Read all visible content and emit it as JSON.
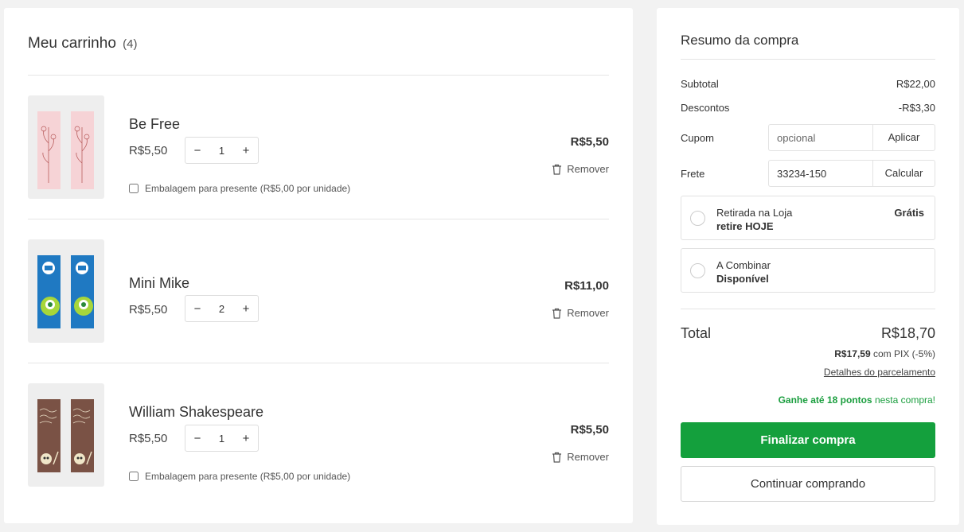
{
  "cart": {
    "title": "Meu carrinho",
    "count": "(4)",
    "items": [
      {
        "name": "Be Free",
        "unit_price": "R$5,50",
        "qty": "1",
        "total": "R$5,50",
        "remove_label": "Remover",
        "gift_label": "Embalagem para presente (R$5,00 por unidade)",
        "thumb_colors": [
          "#f6d3d6",
          "#b85c5c"
        ]
      },
      {
        "name": "Mini Mike",
        "unit_price": "R$5,50",
        "qty": "2",
        "total": "R$11,00",
        "remove_label": "Remover",
        "thumb_colors": [
          "#1f79c2",
          "#a7d63a"
        ]
      },
      {
        "name": "William Shakespeare",
        "unit_price": "R$5,50",
        "qty": "1",
        "total": "R$5,50",
        "remove_label": "Remover",
        "gift_label": "Embalagem para presente (R$5,00 por unidade)",
        "thumb_colors": [
          "#7a5245",
          "#f0e6c8"
        ]
      }
    ],
    "qty_minus": "−",
    "qty_plus": "+"
  },
  "summary": {
    "title": "Resumo da compra",
    "subtotal_label": "Subtotal",
    "subtotal_value": "R$22,00",
    "discount_label": "Descontos",
    "discount_value": "-R$3,30",
    "coupon_label": "Cupom",
    "coupon_placeholder": "opcional",
    "coupon_action": "Aplicar",
    "shipping_label": "Frete",
    "shipping_value": "33234-150",
    "shipping_action": "Calcular",
    "options": [
      {
        "name": "Retirada na Loja",
        "sub": "retire HOJE",
        "price": "Grátis"
      },
      {
        "name": "A Combinar",
        "sub": "Disponível",
        "price": ""
      }
    ],
    "total_label": "Total",
    "total_value": "R$18,70",
    "pix_value": "R$17,59",
    "pix_text": "com PIX (-5%)",
    "installments_link": "Detalhes do parcelamento",
    "points_prefix": "Ganhe até",
    "points_value": "18 pontos",
    "points_suffix": "nesta compra!",
    "checkout_button": "Finalizar compra",
    "continue_button": "Continuar comprando"
  },
  "colors": {
    "accent_green": "#14a03d",
    "points_green": "#1a9e3e"
  }
}
